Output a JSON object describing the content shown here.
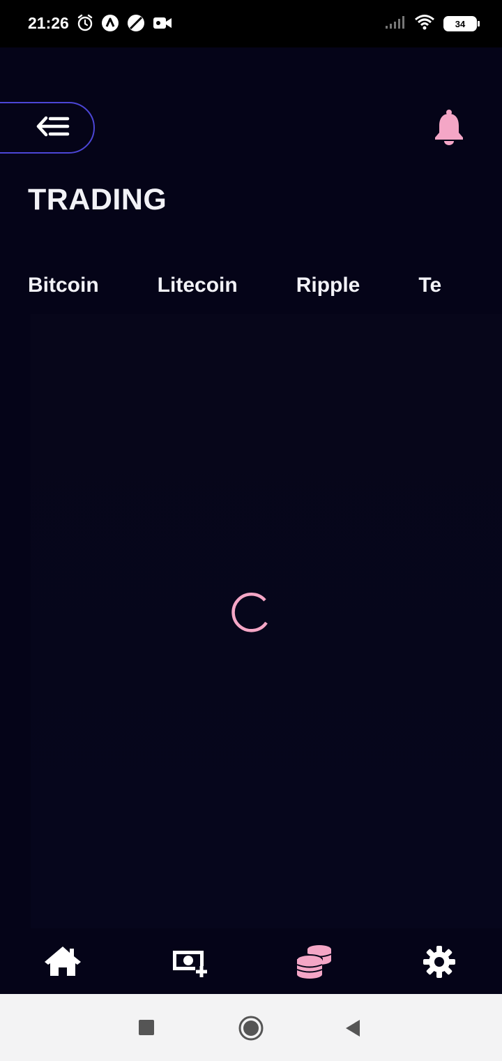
{
  "status_bar": {
    "time": "21:26",
    "battery": "34",
    "left_icons": [
      "alarm-icon",
      "app-a-icon",
      "no-sim-icon",
      "video-record-icon"
    ],
    "right_icons": [
      "signal-icon",
      "wifi-icon",
      "battery-icon"
    ]
  },
  "header": {
    "menu_icon": "menu-back-icon",
    "notification_icon": "bell-icon",
    "title": "TRADING"
  },
  "tabs": [
    {
      "label": "Bitcoin"
    },
    {
      "label": "Litecoin"
    },
    {
      "label": "Ripple"
    },
    {
      "label": "Te"
    }
  ],
  "content": {
    "loading": true
  },
  "bottom_nav": {
    "items": [
      {
        "icon": "home-icon",
        "active": false
      },
      {
        "icon": "add-money-icon",
        "active": false
      },
      {
        "icon": "coins-icon",
        "active": true
      },
      {
        "icon": "settings-icon",
        "active": false
      }
    ]
  },
  "colors": {
    "background": "#050418",
    "accent": "#f4a6c6",
    "pill_border": "#4c46d6",
    "text": "#f2f2f7"
  }
}
